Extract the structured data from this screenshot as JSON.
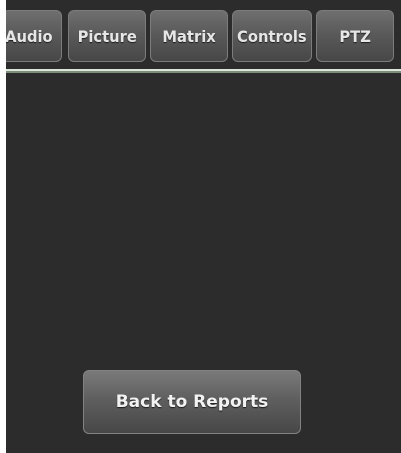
{
  "tabs": [
    {
      "label": "Audio"
    },
    {
      "label": "Picture"
    },
    {
      "label": "Matrix"
    },
    {
      "label": "Controls"
    },
    {
      "label": "PTZ"
    }
  ],
  "main": {
    "back_button_label": "Back to Reports"
  }
}
